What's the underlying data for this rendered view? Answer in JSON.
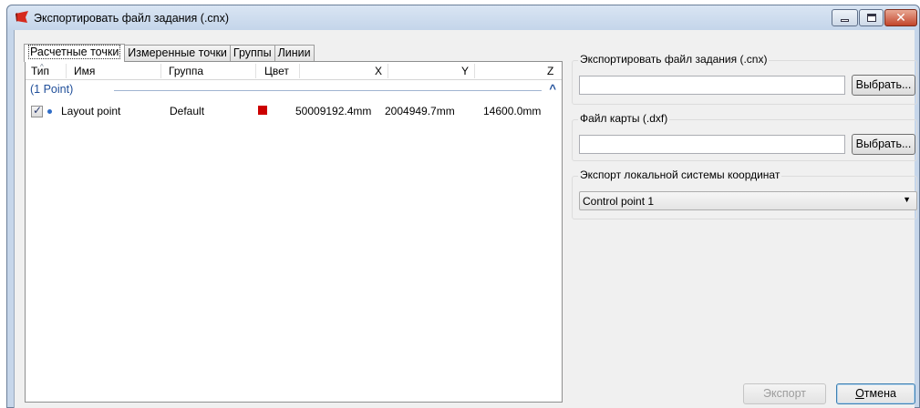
{
  "window": {
    "title": "Экспортировать файл задания (.cnx)"
  },
  "tabs": [
    {
      "label": "Расчетные точки"
    },
    {
      "label": "Измеренные точки"
    },
    {
      "label": "Группы"
    },
    {
      "label": "Линии"
    }
  ],
  "table": {
    "columns": [
      "Тип",
      "Имя",
      "Группа",
      "Цвет",
      "X",
      "Y",
      "Z"
    ],
    "group_label": "(1 Point)",
    "rows": [
      {
        "checked": true,
        "name": "Layout point",
        "group": "Default",
        "color": "#cc0000",
        "x": "50009192.4mm",
        "y": "2004949.7mm",
        "z": "14600.0mm"
      }
    ]
  },
  "export_file": {
    "label": "Экспортировать файл задания (.cnx)",
    "value": "",
    "button": "Выбрать..."
  },
  "map_file": {
    "label": "Файл карты (.dxf)",
    "value": "",
    "button": "Выбрать..."
  },
  "local_cs": {
    "label": "Экспорт локальной системы координат",
    "selected": "Control point 1"
  },
  "footer": {
    "export_label": "Экспорт",
    "cancel_first": "О",
    "cancel_rest": "тмена"
  },
  "icons": {
    "app": "red-flag-icon",
    "minimize": "minimize-icon",
    "maximize": "maximize-icon",
    "close": "close-icon",
    "chevron": "chevron-up-icon",
    "dropdown": "chevron-down-icon",
    "point": "point-dot-icon"
  }
}
